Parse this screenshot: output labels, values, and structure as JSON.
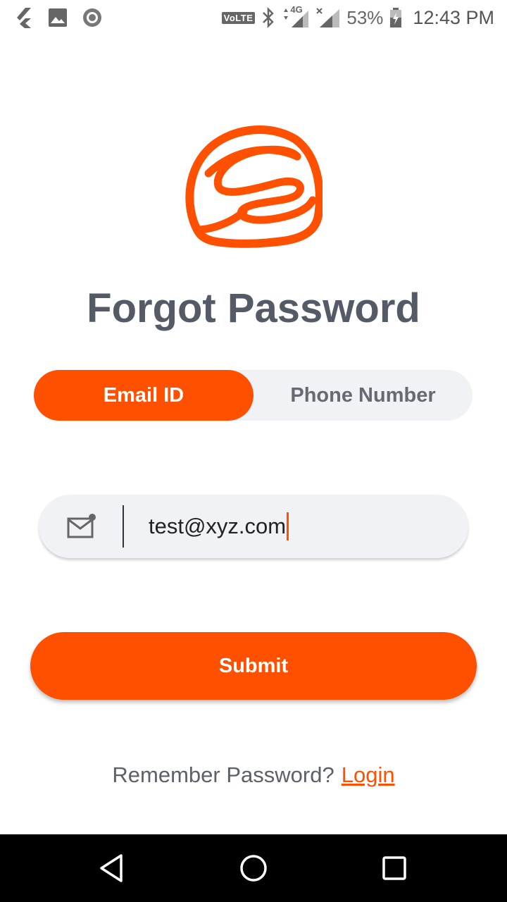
{
  "status_bar": {
    "volte": "VoLTE",
    "network": "4G",
    "battery": "53%",
    "time": "12:43 PM"
  },
  "page": {
    "title": "Forgot Password"
  },
  "tabs": [
    {
      "label": "Email ID",
      "active": true
    },
    {
      "label": "Phone Number",
      "active": false
    }
  ],
  "email_input": {
    "value": "test@xyz.com",
    "icon": "mail-icon"
  },
  "submit": {
    "label": "Submit"
  },
  "footer": {
    "prompt": "Remember Password?",
    "link": "Login"
  },
  "colors": {
    "accent": "#ff5000",
    "title": "#545b66",
    "field_bg": "#f1f2f6"
  }
}
